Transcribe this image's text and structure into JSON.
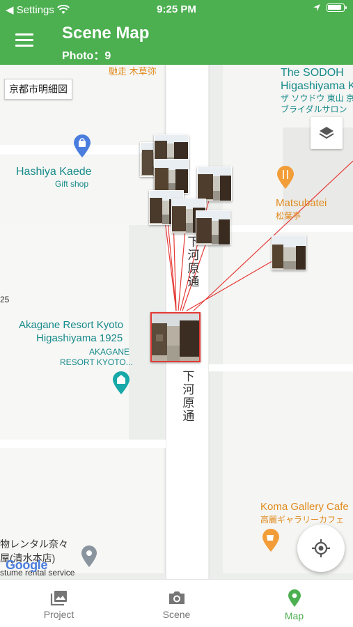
{
  "status_bar": {
    "back_label": "◀ Settings",
    "time": "9:25 PM"
  },
  "app_bar": {
    "title": "Scene Map",
    "subtitle": "Photo：9"
  },
  "map": {
    "map_name": "京都市明細図",
    "labels": {
      "top_shop": "馳走 木草弥",
      "sodoh_1": "The SODOH",
      "sodoh_2": "Higashiyama K",
      "sodoh_3": "ザ ソウドウ 東山 京",
      "sodoh_4": "ブライダルサロン",
      "hashiya_1": "Hashiya Kaede",
      "hashiya_2": "Gift shop",
      "matsubatei_1": "Matsubatei",
      "matsubatei_2": "松葉亭",
      "street_1": "下河原通",
      "street_2": "下河原通",
      "edge_num": "25",
      "akagane_1": "Akagane Resort Kyoto",
      "akagane_2": "Higashiyama 1925",
      "akagane_3": "AKAGANE",
      "akagane_4": "RESORT KYOTO...",
      "koma_1": "Koma Gallery Cafe",
      "koma_2": "高麗ギャラリーカフェ",
      "rental_1": "物レンタル奈々",
      "rental_2": "屋(清水本店)",
      "rental_3": "stume rental service",
      "google": "Google"
    },
    "photo_count": 9,
    "colors": {
      "brand": "#4caf50",
      "connector": "#e53935",
      "teal_poi": "#168a8a",
      "orange_poi": "#e08a1d"
    }
  },
  "bottom_nav": {
    "items": [
      {
        "label": "Project",
        "icon": "photo-library-icon",
        "active": false
      },
      {
        "label": "Scene",
        "icon": "camera-icon",
        "active": false
      },
      {
        "label": "Map",
        "icon": "map-pin-icon",
        "active": true
      }
    ]
  }
}
